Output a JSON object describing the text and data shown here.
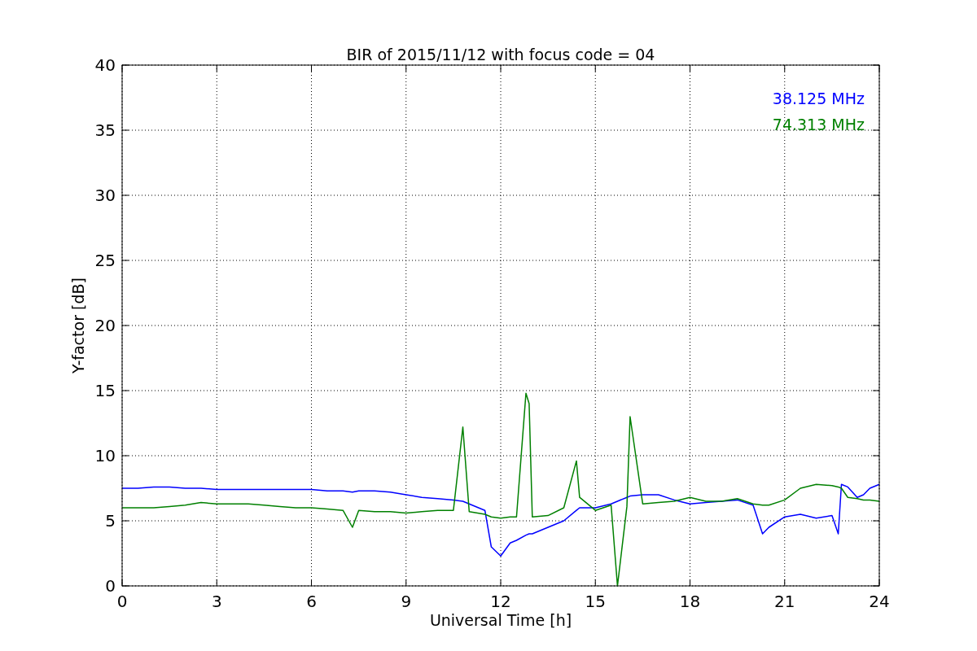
{
  "chart_data": {
    "type": "line",
    "title": "BIR of 2015/11/12 with focus code = 04",
    "xlabel": "Universal Time [h]",
    "ylabel": "Y-factor [dB]",
    "x": [
      0,
      0.5,
      1,
      1.5,
      2,
      2.5,
      3,
      3.5,
      4,
      4.5,
      5,
      5.5,
      6,
      6.5,
      7,
      7.3,
      7.5,
      8,
      8.5,
      9,
      9.5,
      10,
      10.5,
      10.8,
      11,
      11.5,
      11.7,
      12,
      12.3,
      12.5,
      12.8,
      12.9,
      13,
      13.5,
      14,
      14.4,
      14.5,
      15,
      15.5,
      15.7,
      16,
      16.1,
      16.5,
      17,
      17.5,
      18,
      18.5,
      19,
      19.5,
      20,
      20.3,
      20.5,
      21,
      21.5,
      22,
      22.5,
      22.7,
      22.8,
      23,
      23.3,
      23.5,
      23.7,
      24
    ],
    "series": [
      {
        "name": "38.125 MHz",
        "color": "#0000ff",
        "values": [
          7.5,
          7.5,
          7.6,
          7.6,
          7.5,
          7.5,
          7.4,
          7.4,
          7.4,
          7.4,
          7.4,
          7.4,
          7.4,
          7.3,
          7.3,
          7.2,
          7.3,
          7.3,
          7.2,
          7.0,
          6.8,
          6.7,
          6.6,
          6.5,
          6.3,
          5.8,
          3.0,
          2.3,
          3.3,
          3.5,
          3.9,
          4.0,
          4.0,
          4.5,
          5.0,
          5.8,
          6.0,
          6.0,
          6.3,
          6.5,
          6.8,
          6.9,
          7.0,
          7.0,
          6.6,
          6.3,
          6.4,
          6.5,
          6.6,
          6.2,
          4.0,
          4.5,
          5.3,
          5.5,
          5.2,
          5.4,
          4.0,
          7.8,
          7.6,
          6.8,
          7.0,
          7.5,
          7.8
        ]
      },
      {
        "name": "74.313 MHz",
        "color": "#008000",
        "values": [
          6.0,
          6.0,
          6.0,
          6.1,
          6.2,
          6.4,
          6.3,
          6.3,
          6.3,
          6.2,
          6.1,
          6.0,
          6.0,
          5.9,
          5.8,
          4.5,
          5.8,
          5.7,
          5.7,
          5.6,
          5.7,
          5.8,
          5.8,
          12.2,
          5.7,
          5.5,
          5.3,
          5.2,
          5.3,
          5.3,
          14.8,
          14.0,
          5.3,
          5.4,
          6.0,
          9.6,
          6.8,
          5.8,
          6.2,
          0.0,
          6.1,
          13.0,
          6.3,
          6.4,
          6.5,
          6.8,
          6.5,
          6.5,
          6.7,
          6.3,
          6.2,
          6.2,
          6.6,
          7.5,
          7.8,
          7.7,
          7.6,
          7.5,
          6.8,
          6.7,
          6.6,
          6.6,
          6.5
        ]
      }
    ],
    "grid": true,
    "xlim": [
      0,
      24
    ],
    "ylim": [
      0,
      40
    ],
    "xticks": [
      0,
      3,
      6,
      9,
      12,
      15,
      18,
      21,
      24
    ],
    "yticks": [
      0,
      5,
      10,
      15,
      20,
      25,
      30,
      35,
      40
    ]
  }
}
